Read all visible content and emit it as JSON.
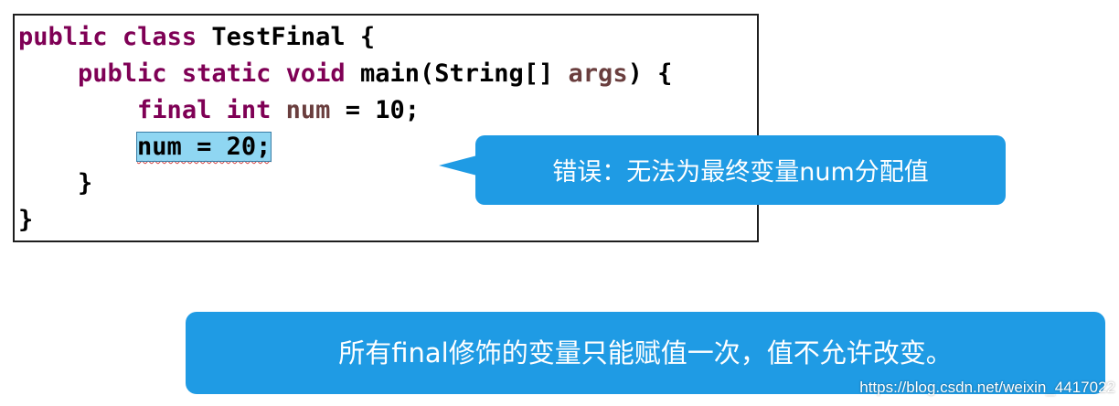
{
  "colors": {
    "keyword": "#7f0055",
    "identifier": "#6a3e3e",
    "plain": "#000000",
    "selection": "#8fd6f2",
    "callout": "#1f9be4"
  },
  "code": {
    "line1": {
      "kw1": "public",
      "kw2": "class",
      "rest": "TestFinal {"
    },
    "line2": {
      "kw1": "public",
      "kw2": "static",
      "kw3": "void",
      "name": "main(String[]",
      "arg": "args",
      "rest": ") {"
    },
    "line3": {
      "kw1": "final",
      "kw2": "int",
      "var": "num",
      "rest": "= 10;"
    },
    "line4": {
      "selected": "num = 20;"
    },
    "line5": {
      "brace": "}"
    },
    "line6": {
      "brace": "}"
    }
  },
  "callout": {
    "text": "错误：无法为最终变量num分配值"
  },
  "note": {
    "text": "所有final修饰的变量只能赋值一次，值不允许改变。"
  },
  "watermark": {
    "text": "https://blog.csdn.net/weixin_4417022"
  }
}
